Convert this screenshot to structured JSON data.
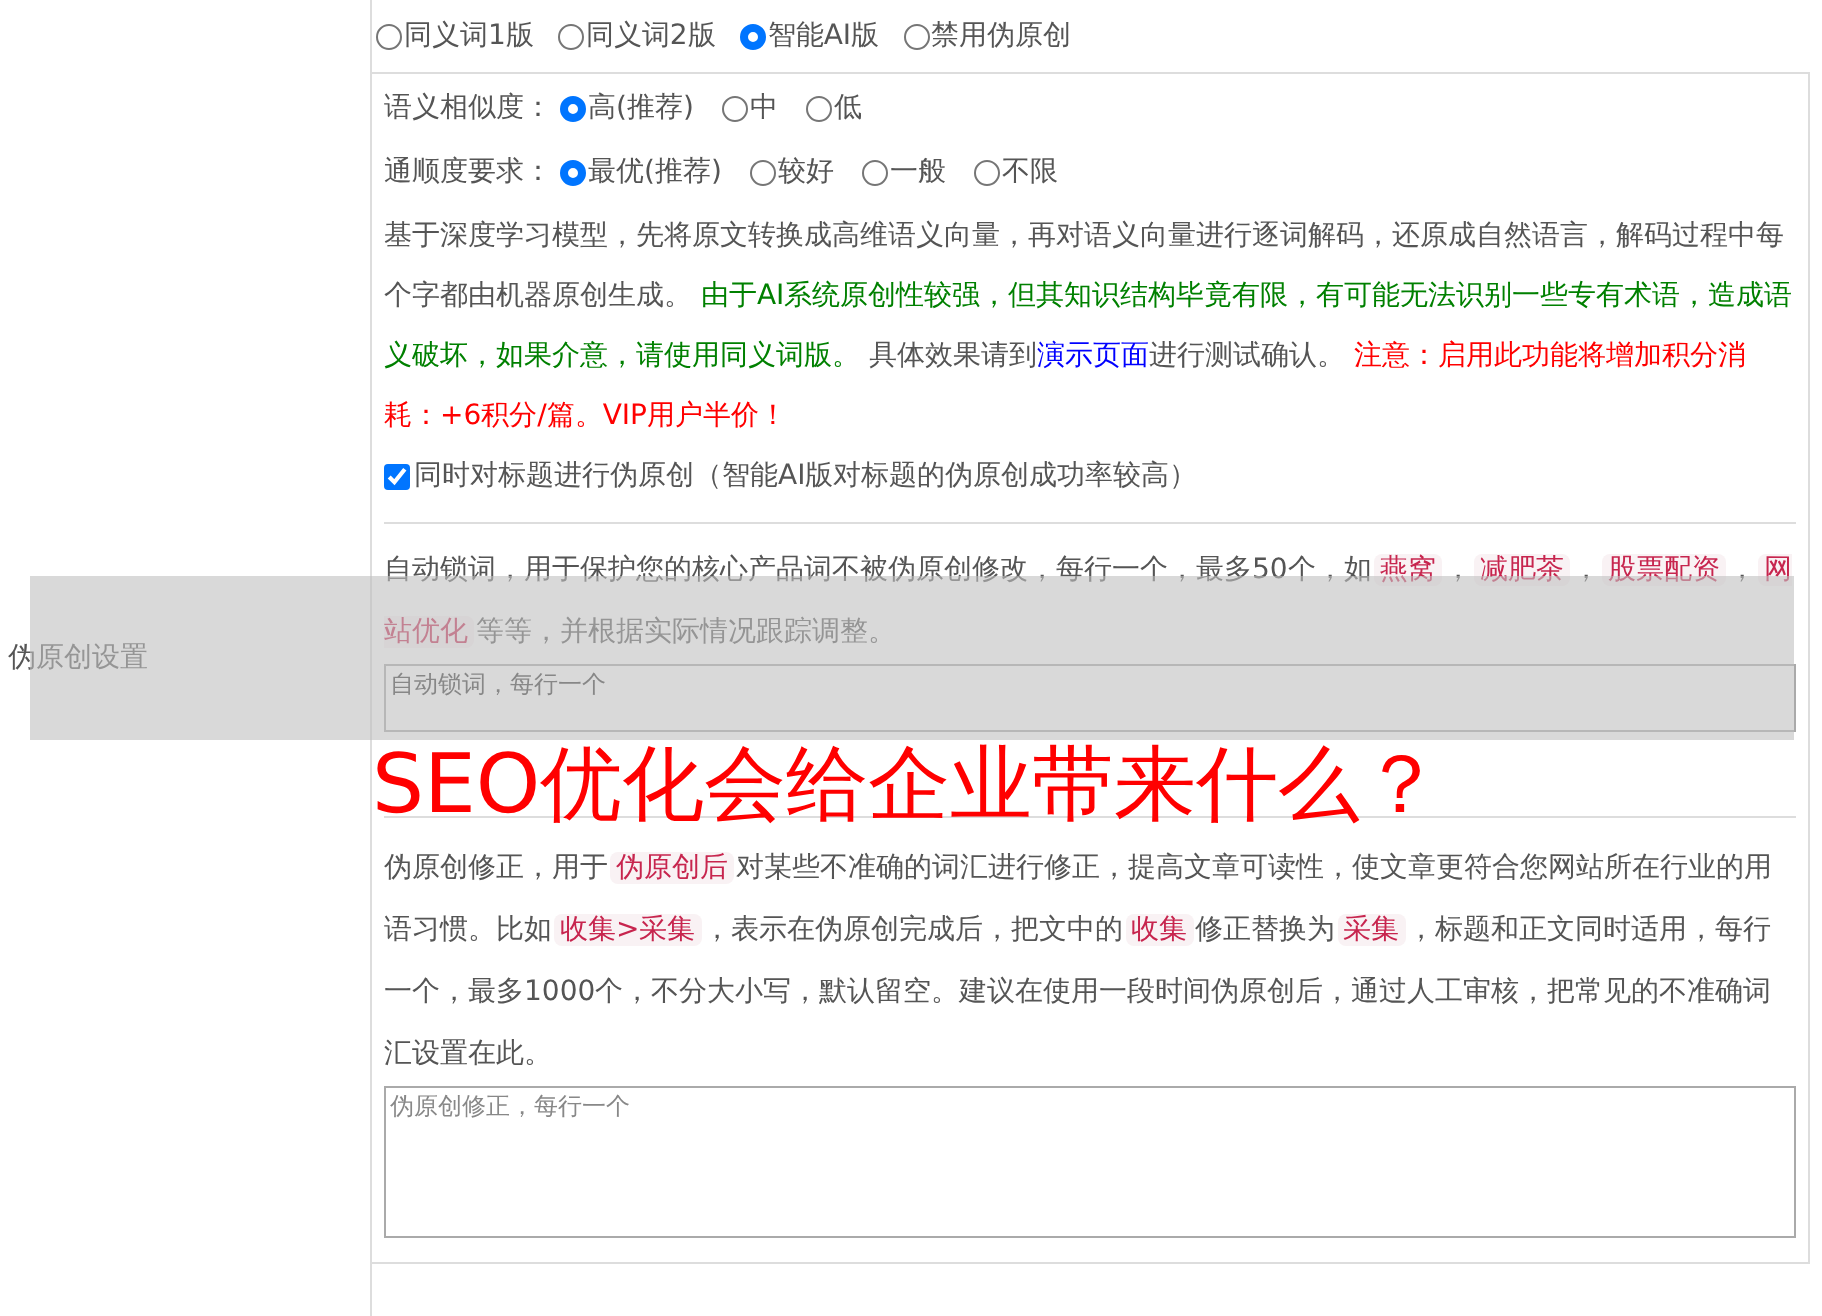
{
  "side_label": "伪原创设置",
  "modes": [
    {
      "label": "同义词1版",
      "selected": false
    },
    {
      "label": "同义词2版",
      "selected": false
    },
    {
      "label": "智能AI版",
      "selected": true
    },
    {
      "label": "禁用伪原创",
      "selected": false
    }
  ],
  "option_groups": [
    {
      "label": "语义相似度：",
      "options": [
        {
          "label": "高(推荐)",
          "selected": true
        },
        {
          "label": "中",
          "selected": false
        },
        {
          "label": "低",
          "selected": false
        }
      ]
    },
    {
      "label": "通顺度要求：",
      "options": [
        {
          "label": "最优(推荐)",
          "selected": true
        },
        {
          "label": "较好",
          "selected": false
        },
        {
          "label": "一般",
          "selected": false
        },
        {
          "label": "不限",
          "selected": false
        }
      ]
    }
  ],
  "description": [
    {
      "kind": "normal",
      "text": "基于深度学习模型，先将原文转换成高维语义向量，再对语义向量进行逐词解码，还原成自然语言，解码过程中每个字都由机器原创生成。 "
    },
    {
      "kind": "notice",
      "text": "由于AI系统原创性较强，但其知识结构毕竟有限，有可能无法识别一些专有术语，造成语义破坏，如果介意，请使用同义词版。"
    },
    {
      "kind": "normal",
      "text": " 具体效果请到"
    },
    {
      "kind": "link",
      "text": "演示页面"
    },
    {
      "kind": "normal",
      "text": "进行测试确认。 "
    },
    {
      "kind": "warning",
      "text": "注意：启用此功能将增加积分消耗：+6积分/篇。VIP用户半价！"
    }
  ],
  "title_option": {
    "label": "同时对标题进行伪原创（智能AI版对标题的伪原创成功率较高）",
    "checked": true
  },
  "lock_words": {
    "help": [
      {
        "kind": "normal",
        "text": "自动锁词，用于保护您的核心产品词不被伪原创修改，每行一个，最多50个，如"
      },
      {
        "kind": "code",
        "text": "燕窝"
      },
      {
        "kind": "normal",
        "text": "，"
      },
      {
        "kind": "code",
        "text": "减肥茶"
      },
      {
        "kind": "normal",
        "text": "，"
      },
      {
        "kind": "code",
        "text": "股票配资"
      },
      {
        "kind": "normal",
        "text": "，"
      },
      {
        "kind": "code",
        "text": "网站优化"
      },
      {
        "kind": "normal",
        "text": "等等，并根据实际情况跟踪调整。"
      }
    ],
    "placeholder": "自动锁词，每行一个"
  },
  "corrections": {
    "help": [
      {
        "kind": "normal",
        "text": "伪原创修正，用于"
      },
      {
        "kind": "code",
        "text": "伪原创后"
      },
      {
        "kind": "normal",
        "text": "对某些不准确的词汇进行修正，提高文章可读性，使文章更符合您网站所在行业的用语习惯。比如"
      },
      {
        "kind": "code",
        "text": "收集>采集"
      },
      {
        "kind": "normal",
        "text": "，表示在伪原创完成后，把文中的"
      },
      {
        "kind": "code",
        "text": "收集"
      },
      {
        "kind": "normal",
        "text": "修正替换为"
      },
      {
        "kind": "code",
        "text": "采集"
      },
      {
        "kind": "normal",
        "text": "，标题和正文同时适用，每行一个，最多1000个，不分大小写，默认留空。建议在使用一段时间伪原创后，通过人工审核，把常见的不准确词汇设置在此。"
      }
    ],
    "placeholder": "伪原创修正，每行一个"
  },
  "banner": {
    "title": "SEO优化会给企业带来什么？"
  }
}
